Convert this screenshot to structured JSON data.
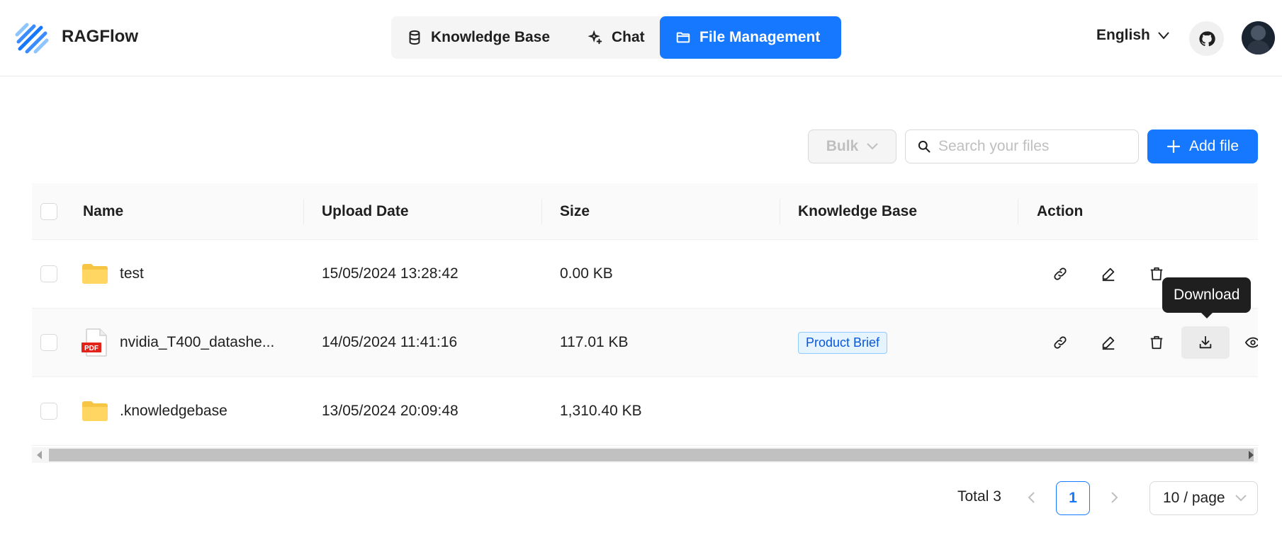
{
  "header": {
    "app_title": "RAGFlow",
    "nav_tabs": [
      {
        "label": "Knowledge Base",
        "icon": "database-icon"
      },
      {
        "label": "Chat",
        "icon": "sparkle-icon"
      },
      {
        "label": "File Management",
        "icon": "folder-icon",
        "active": true
      }
    ],
    "language": "English",
    "accent_color": "#1677ff"
  },
  "toolbar": {
    "bulk_label": "Bulk",
    "search_placeholder": "Search your files",
    "add_file_label": "Add file"
  },
  "table": {
    "columns": [
      "Name",
      "Upload Date",
      "Size",
      "Knowledge Base",
      "Action"
    ],
    "rows": [
      {
        "name": "test",
        "type": "folder",
        "upload_date": "15/05/2024 13:28:42",
        "size": "0.00 KB",
        "knowledge_base": ""
      },
      {
        "name": "nvidia_T400_datashe...",
        "type": "pdf",
        "upload_date": "14/05/2024 11:41:16",
        "size": "117.01 KB",
        "knowledge_base": "Product Brief"
      },
      {
        "name": ".knowledgebase",
        "type": "folder",
        "upload_date": "13/05/2024 20:09:48",
        "size": "1,310.40 KB",
        "knowledge_base": ""
      }
    ],
    "tooltip": "Download",
    "pdf_badge": "PDF"
  },
  "pagination": {
    "total_label": "Total 3",
    "current_page": "1",
    "page_size": "10 / page"
  }
}
